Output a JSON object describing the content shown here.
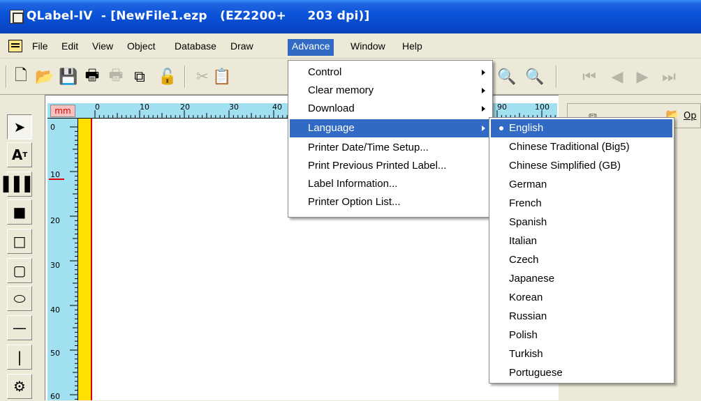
{
  "window": {
    "title": "QLabel-IV  - [NewFile1.ezp   (EZ2200+     203 dpi)]"
  },
  "menubar": {
    "items": [
      "File",
      "Edit",
      "View",
      "Object",
      "Database",
      "Draw",
      "Advance",
      "Window",
      "Help"
    ],
    "active": "Advance"
  },
  "ruler": {
    "unit": "mm",
    "top_labels": [
      "0",
      "10",
      "20",
      "30",
      "40",
      "90",
      "100"
    ],
    "left_labels": [
      "0",
      "10",
      "20",
      "30",
      "40",
      "50",
      "60"
    ]
  },
  "advance_menu": {
    "items": [
      {
        "label": "Control",
        "submenu": true
      },
      {
        "label": "Clear memory",
        "submenu": true
      },
      {
        "label": "Download",
        "submenu": true
      },
      {
        "label": "Language",
        "submenu": true,
        "highlighted": true
      },
      {
        "label": "Printer Date/Time Setup...",
        "submenu": false
      },
      {
        "label": "Print Previous Printed Label...",
        "submenu": false
      },
      {
        "label": "Label Information...",
        "submenu": false
      },
      {
        "label": "Printer Option List...",
        "submenu": false
      }
    ]
  },
  "language_menu": {
    "selected": "English",
    "items": [
      "English",
      "Chinese Traditional (Big5)",
      "Chinese Simplified (GB)",
      "German",
      "French",
      "Spanish",
      "Italian",
      "Czech",
      "Japanese",
      "Korean",
      "Russian",
      "Polish",
      "Turkish",
      "Portuguese"
    ]
  },
  "right_pane": {
    "button_label": "Op"
  },
  "colors": {
    "titlebar": "#0a52d8",
    "highlight": "#316ac5",
    "ruler": "#a0e0f0",
    "yellow_strip": "#ffe000"
  }
}
